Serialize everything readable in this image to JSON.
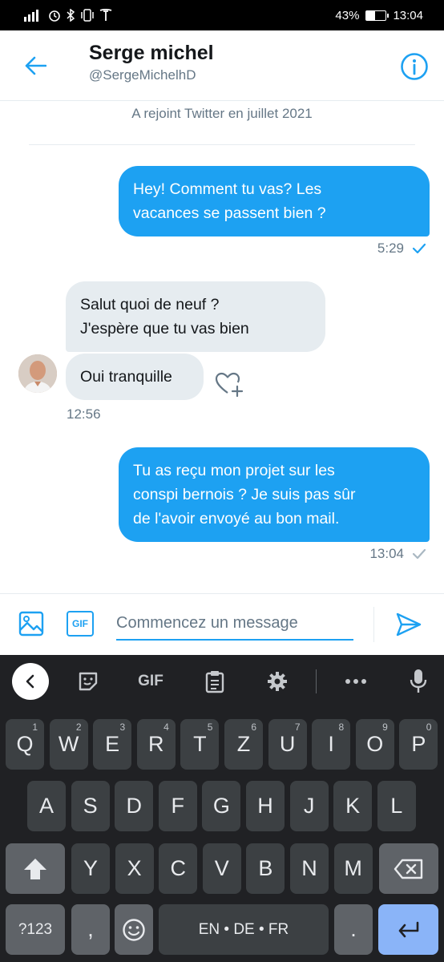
{
  "status_bar": {
    "battery": "43%",
    "battery_level": 0.43,
    "time": "13:04"
  },
  "header": {
    "name": "Serge michel",
    "handle": "@SergeMichelhD"
  },
  "joined_text": "A rejoint Twitter en juillet 2021",
  "messages": [
    {
      "direction": "out",
      "text": "Hey! Comment tu vas? Les\nvacances se passent bien ?",
      "time": "5:29",
      "status": "seen"
    },
    {
      "direction": "in",
      "text": "Salut quoi de neuf ?\nJ'espère que tu vas bien"
    },
    {
      "direction": "in",
      "text": "Oui tranquille",
      "time": "12:56"
    },
    {
      "direction": "out",
      "text": "Tu as reçu mon projet sur les\nconspi bernois ? Je suis pas sûr\nde l'avoir envoyé au bon mail.",
      "time": "13:04",
      "status": "sent"
    }
  ],
  "composer": {
    "gif_label": "GIF",
    "placeholder": "Commencez un message"
  },
  "keyboard": {
    "toolbar": {
      "gif_label": "GIF"
    },
    "row1": [
      {
        "k": "Q",
        "s": "1"
      },
      {
        "k": "W",
        "s": "2"
      },
      {
        "k": "E",
        "s": "3"
      },
      {
        "k": "R",
        "s": "4"
      },
      {
        "k": "T",
        "s": "5"
      },
      {
        "k": "Z",
        "s": "6"
      },
      {
        "k": "U",
        "s": "7"
      },
      {
        "k": "I",
        "s": "8"
      },
      {
        "k": "O",
        "s": "9"
      },
      {
        "k": "P",
        "s": "0"
      }
    ],
    "row2": [
      "A",
      "S",
      "D",
      "F",
      "G",
      "H",
      "J",
      "K",
      "L"
    ],
    "row3": [
      "Y",
      "X",
      "C",
      "V",
      "B",
      "N",
      "M"
    ],
    "symbols_label": "?123",
    "comma": ",",
    "space_label": "EN • DE • FR",
    "period": "."
  },
  "colors": {
    "accent": "#1da1f2",
    "keyboard_bg": "#202124",
    "key": "#3c4043",
    "enter_key": "#8ab4f8"
  }
}
